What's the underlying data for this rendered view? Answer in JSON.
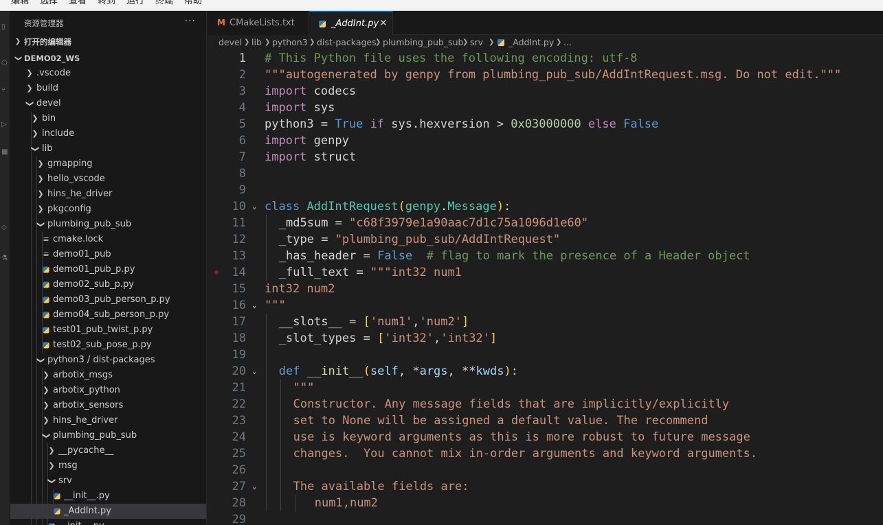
{
  "menubar": {
    "items": [
      "编辑",
      "选择",
      "查看",
      "转到",
      "运行",
      "终端",
      "帮助"
    ]
  },
  "sidebar": {
    "title": "资源管理器",
    "more": "···",
    "open_editors": "打开的编辑器",
    "workspace": "DEMO02_WS",
    "tree": [
      {
        "name": ".vscode",
        "depth": 0,
        "kind": "folder",
        "open": false
      },
      {
        "name": "build",
        "depth": 0,
        "kind": "folder",
        "open": false
      },
      {
        "name": "devel",
        "depth": 0,
        "kind": "folder",
        "open": true
      },
      {
        "name": "bin",
        "depth": 1,
        "kind": "folder",
        "open": false
      },
      {
        "name": "include",
        "depth": 1,
        "kind": "folder",
        "open": false
      },
      {
        "name": "lib",
        "depth": 1,
        "kind": "folder",
        "open": true
      },
      {
        "name": "gmapping",
        "depth": 2,
        "kind": "folder",
        "open": false
      },
      {
        "name": "hello_vscode",
        "depth": 2,
        "kind": "folder",
        "open": false
      },
      {
        "name": "hins_he_driver",
        "depth": 2,
        "kind": "folder",
        "open": false
      },
      {
        "name": "pkgconfig",
        "depth": 2,
        "kind": "folder",
        "open": false
      },
      {
        "name": "plumbing_pub_sub",
        "depth": 2,
        "kind": "folder",
        "open": true
      },
      {
        "name": "cmake.lock",
        "depth": 3,
        "kind": "lock"
      },
      {
        "name": "demo01_pub",
        "depth": 3,
        "kind": "lock"
      },
      {
        "name": "demo01_pub_p.py",
        "depth": 3,
        "kind": "py"
      },
      {
        "name": "demo02_sub_p.py",
        "depth": 3,
        "kind": "py"
      },
      {
        "name": "demo03_pub_person_p.py",
        "depth": 3,
        "kind": "py"
      },
      {
        "name": "demo04_sub_person_p.py",
        "depth": 3,
        "kind": "py"
      },
      {
        "name": "test01_pub_twist_p.py",
        "depth": 3,
        "kind": "py"
      },
      {
        "name": "test02_sub_pose_p.py",
        "depth": 3,
        "kind": "py"
      },
      {
        "name": "python3 / dist-packages",
        "depth": 2,
        "kind": "folder",
        "open": true
      },
      {
        "name": "arbotix_msgs",
        "depth": 3,
        "kind": "folder",
        "open": false
      },
      {
        "name": "arbotix_python",
        "depth": 3,
        "kind": "folder",
        "open": false
      },
      {
        "name": "arbotix_sensors",
        "depth": 3,
        "kind": "folder",
        "open": false
      },
      {
        "name": "hins_he_driver",
        "depth": 3,
        "kind": "folder",
        "open": false
      },
      {
        "name": "plumbing_pub_sub",
        "depth": 3,
        "kind": "folder",
        "open": true
      },
      {
        "name": "__pycache__",
        "depth": 4,
        "kind": "folder",
        "open": false
      },
      {
        "name": "msg",
        "depth": 4,
        "kind": "folder",
        "open": false
      },
      {
        "name": "srv",
        "depth": 4,
        "kind": "folder",
        "open": true
      },
      {
        "name": "__init__.py",
        "depth": 5,
        "kind": "py"
      },
      {
        "name": "_AddInt.py",
        "depth": 5,
        "kind": "py",
        "selected": true
      },
      {
        "name": "__init__.py",
        "depth": 4,
        "kind": "py"
      }
    ]
  },
  "tabs": [
    {
      "label": "CMakeLists.txt",
      "icon": "M",
      "active": false
    },
    {
      "label": "_AddInt.py",
      "icon": "py",
      "active": true,
      "close": "✕"
    }
  ],
  "breadcrumb": [
    "devel",
    "lib",
    "python3",
    "dist-packages",
    "plumbing_pub_sub",
    "srv",
    "_AddInt.py",
    "..."
  ],
  "editor": {
    "current_line": 1,
    "lines": [
      {
        "n": "1",
        "tokens": [
          [
            "c-com",
            "# This Python file uses the following encoding: utf-8"
          ]
        ]
      },
      {
        "n": "2",
        "tokens": [
          [
            "c-str",
            "\"\"\"autogenerated by genpy from plumbing_pub_sub/AddIntRequest.msg. Do not edit.\"\"\""
          ]
        ]
      },
      {
        "n": "3",
        "tokens": [
          [
            "c-kw",
            "import"
          ],
          [
            "c-op",
            " codecs"
          ]
        ]
      },
      {
        "n": "4",
        "tokens": [
          [
            "c-kw",
            "import"
          ],
          [
            "c-op",
            " sys"
          ]
        ]
      },
      {
        "n": "5",
        "tokens": [
          [
            "c-op",
            "python3 = "
          ],
          [
            "c-blue",
            "True"
          ],
          [
            "c-op",
            " "
          ],
          [
            "c-kw",
            "if"
          ],
          [
            "c-op",
            " sys.hexversion > "
          ],
          [
            "c-num",
            "0x03000000"
          ],
          [
            "c-op",
            " "
          ],
          [
            "c-kw",
            "else"
          ],
          [
            "c-op",
            " "
          ],
          [
            "c-blue",
            "False"
          ]
        ]
      },
      {
        "n": "6",
        "tokens": [
          [
            "c-kw",
            "import"
          ],
          [
            "c-op",
            " genpy"
          ]
        ]
      },
      {
        "n": "7",
        "tokens": [
          [
            "c-kw",
            "import"
          ],
          [
            "c-op",
            " struct"
          ]
        ]
      },
      {
        "n": "8",
        "tokens": []
      },
      {
        "n": "9",
        "tokens": []
      },
      {
        "n": "10",
        "fold": true,
        "tokens": [
          [
            "c-blue",
            "class"
          ],
          [
            "c-op",
            " "
          ],
          [
            "c-cls",
            "AddIntRequest"
          ],
          [
            "c-br",
            "("
          ],
          [
            "c-cls",
            "genpy"
          ],
          [
            "c-op",
            "."
          ],
          [
            "c-cls",
            "Message"
          ],
          [
            "c-br",
            ")"
          ],
          [
            "c-op",
            ":"
          ]
        ]
      },
      {
        "n": "11",
        "indent": 1,
        "tokens": [
          [
            "c-op",
            "_md5sum = "
          ],
          [
            "c-str",
            "\"c68f3979e1a90aac7d1c75a1096d1e60\""
          ]
        ]
      },
      {
        "n": "12",
        "indent": 1,
        "tokens": [
          [
            "c-op",
            "_type = "
          ],
          [
            "c-str",
            "\"plumbing_pub_sub/AddIntRequest\""
          ]
        ]
      },
      {
        "n": "13",
        "indent": 1,
        "tokens": [
          [
            "c-op",
            "_has_header = "
          ],
          [
            "c-blue",
            "False"
          ],
          [
            "c-op",
            "  "
          ],
          [
            "c-com",
            "# flag to mark the presence of a Header object"
          ]
        ]
      },
      {
        "n": "14",
        "indent": 1,
        "bp": true,
        "tokens": [
          [
            "c-op",
            "_full_text = "
          ],
          [
            "c-str",
            "\"\"\"int32 num1"
          ]
        ]
      },
      {
        "n": "15",
        "tokens": [
          [
            "c-str",
            "int32 num2"
          ]
        ]
      },
      {
        "n": "16",
        "fold": true,
        "tokens": [
          [
            "c-str",
            "\"\"\""
          ]
        ]
      },
      {
        "n": "17",
        "indent": 1,
        "tokens": [
          [
            "c-op",
            "__slots__ = "
          ],
          [
            "c-br",
            "["
          ],
          [
            "c-str",
            "'num1'"
          ],
          [
            "c-op",
            ","
          ],
          [
            "c-str",
            "'num2'"
          ],
          [
            "c-br",
            "]"
          ]
        ]
      },
      {
        "n": "18",
        "indent": 1,
        "tokens": [
          [
            "c-op",
            "_slot_types = "
          ],
          [
            "c-br",
            "["
          ],
          [
            "c-str",
            "'int32'"
          ],
          [
            "c-op",
            ","
          ],
          [
            "c-str",
            "'int32'"
          ],
          [
            "c-br",
            "]"
          ]
        ]
      },
      {
        "n": "19",
        "indent": 1,
        "tokens": []
      },
      {
        "n": "20",
        "indent": 1,
        "fold": true,
        "tokens": [
          [
            "c-blue",
            "def"
          ],
          [
            "c-op",
            " "
          ],
          [
            "c-fn",
            "__init__"
          ],
          [
            "c-br",
            "("
          ],
          [
            "c-var",
            "self"
          ],
          [
            "c-op",
            ", *"
          ],
          [
            "c-var",
            "args"
          ],
          [
            "c-op",
            ", **"
          ],
          [
            "c-var",
            "kwds"
          ],
          [
            "c-br",
            ")"
          ],
          [
            "c-op",
            ":"
          ]
        ]
      },
      {
        "n": "21",
        "indent": 2,
        "tokens": [
          [
            "c-str",
            "\"\"\""
          ]
        ]
      },
      {
        "n": "22",
        "indent": 2,
        "tokens": [
          [
            "c-str",
            "Constructor. Any message fields that are implicitly/explicitly"
          ]
        ]
      },
      {
        "n": "23",
        "indent": 2,
        "tokens": [
          [
            "c-str",
            "set to None will be assigned a default value. The recommend"
          ]
        ]
      },
      {
        "n": "24",
        "indent": 2,
        "tokens": [
          [
            "c-str",
            "use is keyword arguments as this is more robust to future message"
          ]
        ]
      },
      {
        "n": "25",
        "indent": 2,
        "tokens": [
          [
            "c-str",
            "changes.  You cannot mix in-order arguments and keyword arguments."
          ]
        ]
      },
      {
        "n": "26",
        "indent": 2,
        "tokens": []
      },
      {
        "n": "27",
        "indent": 2,
        "fold": true,
        "tokens": [
          [
            "c-str",
            "The available fields are:"
          ]
        ]
      },
      {
        "n": "28",
        "indent": 3,
        "tokens": [
          [
            "c-str",
            "num1,num2"
          ]
        ]
      },
      {
        "n": "29",
        "tokens": []
      }
    ]
  }
}
